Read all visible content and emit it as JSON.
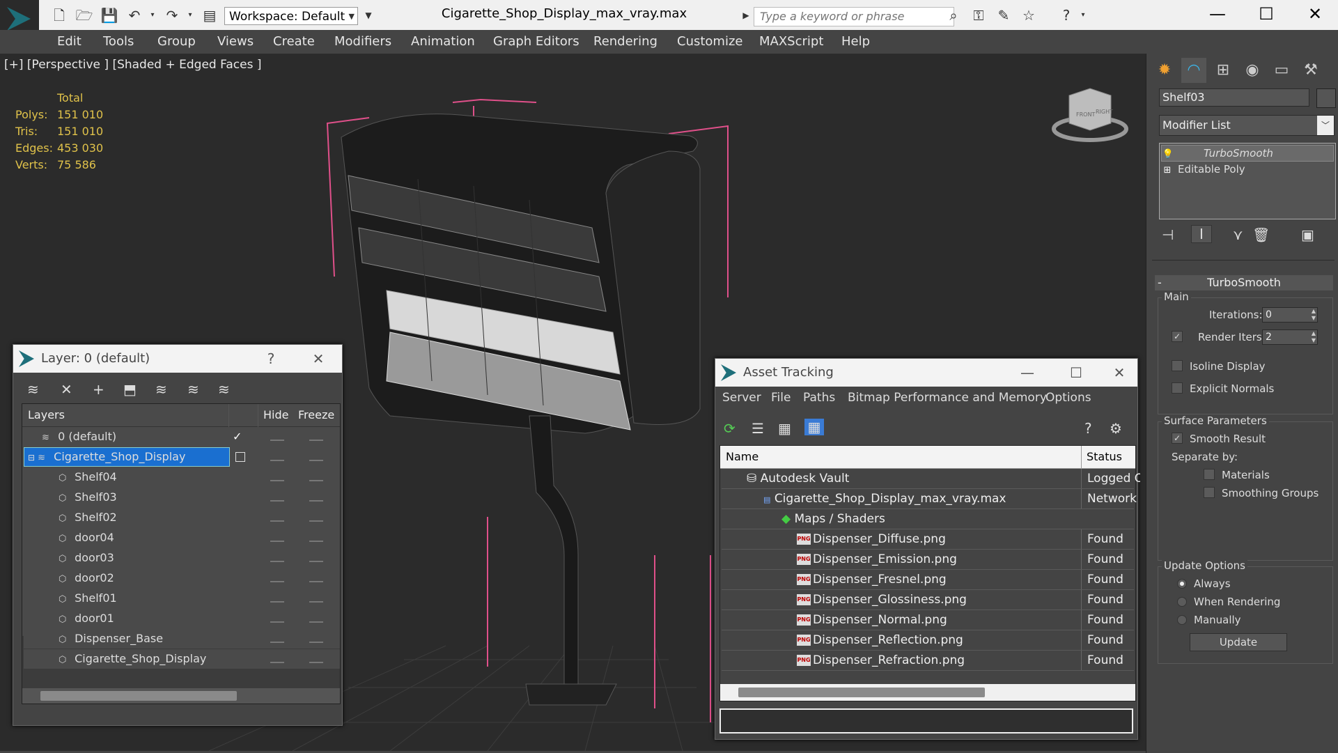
{
  "titlebar": {
    "workspace": "Workspace: Default",
    "window_title": "Cigarette_Shop_Display_max_vray.max",
    "search_placeholder": "Type a keyword or phrase"
  },
  "menu": [
    "Edit",
    "Tools",
    "Group",
    "Views",
    "Create",
    "Modifiers",
    "Animation",
    "Graph Editors",
    "Rendering",
    "Customize",
    "MAXScript",
    "Help"
  ],
  "viewport": {
    "label": "[+] [Perspective ] [Shaded + Edged Faces ]",
    "stats": {
      "header": "Total",
      "rows": [
        {
          "label": "Polys:",
          "value": "151 010"
        },
        {
          "label": "Tris:",
          "value": "151 010"
        },
        {
          "label": "Edges:",
          "value": "453 030"
        },
        {
          "label": "Verts:",
          "value": "75 586"
        }
      ]
    },
    "viewcube_labels": [
      "FRONT",
      "RIGHT"
    ]
  },
  "cmdpanel": {
    "object_name": "Shelf03",
    "modifier_list": "Modifier List",
    "stack": [
      {
        "label": "TurboSmooth",
        "icon": "bulb-icon"
      },
      {
        "label": "Editable Poly",
        "icon": "plus-icon"
      }
    ],
    "rollout_title": "TurboSmooth",
    "main_group": "Main",
    "iterations_label": "Iterations:",
    "iterations_value": "0",
    "render_iters_label": "Render Iters:",
    "render_iters_value": "2",
    "isoline_display": "Isoline Display",
    "explicit_normals": "Explicit Normals",
    "surface_group": "Surface Parameters",
    "smooth_result": "Smooth Result",
    "separate_by": "Separate by:",
    "materials": "Materials",
    "smoothing_groups": "Smoothing Groups",
    "update_group": "Update Options",
    "always": "Always",
    "when_rendering": "When Rendering",
    "manually": "Manually",
    "update_button": "Update"
  },
  "layer_dialog": {
    "title": "Layer: 0 (default)",
    "help": "?",
    "columns": {
      "layers": "Layers",
      "hide": "Hide",
      "freeze": "Freeze"
    },
    "rows": [
      {
        "label": "0 (default)",
        "indent": 1,
        "type": "layer",
        "current": true
      },
      {
        "label": "Cigarette_Shop_Display",
        "indent": 1,
        "type": "layer",
        "selected": true
      },
      {
        "label": "Shelf04",
        "indent": 2,
        "type": "object"
      },
      {
        "label": "Shelf03",
        "indent": 2,
        "type": "object"
      },
      {
        "label": "Shelf02",
        "indent": 2,
        "type": "object"
      },
      {
        "label": "door04",
        "indent": 2,
        "type": "object"
      },
      {
        "label": "door03",
        "indent": 2,
        "type": "object"
      },
      {
        "label": "door02",
        "indent": 2,
        "type": "object"
      },
      {
        "label": "Shelf01",
        "indent": 2,
        "type": "object"
      },
      {
        "label": "door01",
        "indent": 2,
        "type": "object"
      },
      {
        "label": "Dispenser_Base",
        "indent": 2,
        "type": "object"
      },
      {
        "label": "Cigarette_Shop_Display",
        "indent": 2,
        "type": "object"
      }
    ]
  },
  "asset_dialog": {
    "title": "Asset Tracking",
    "menu": [
      "Server",
      "File",
      "Paths",
      "Bitmap Performance and Memory",
      "Options"
    ],
    "columns": {
      "name": "Name",
      "status": "Status"
    },
    "rows": [
      {
        "name": "Autodesk Vault",
        "status": "Logged Out",
        "indent": 1,
        "icon": "vault-icon"
      },
      {
        "name": "Cigarette_Shop_Display_max_vray.max",
        "status": "Network",
        "indent": 2,
        "icon": "max-file-icon"
      },
      {
        "name": "Maps / Shaders",
        "status": "",
        "indent": 3,
        "icon": "maps-icon"
      },
      {
        "name": "Dispenser_Diffuse.png",
        "status": "Found",
        "indent": 4,
        "icon": "png-icon"
      },
      {
        "name": "Dispenser_Emission.png",
        "status": "Found",
        "indent": 4,
        "icon": "png-icon"
      },
      {
        "name": "Dispenser_Fresnel.png",
        "status": "Found",
        "indent": 4,
        "icon": "png-icon"
      },
      {
        "name": "Dispenser_Glossiness.png",
        "status": "Found",
        "indent": 4,
        "icon": "png-icon"
      },
      {
        "name": "Dispenser_Normal.png",
        "status": "Found",
        "indent": 4,
        "icon": "png-icon"
      },
      {
        "name": "Dispenser_Reflection.png",
        "status": "Found",
        "indent": 4,
        "icon": "png-icon"
      },
      {
        "name": "Dispenser_Refraction.png",
        "status": "Found",
        "indent": 4,
        "icon": "png-icon"
      }
    ]
  },
  "colors": {
    "selection": "#1a6fd0",
    "stats_text": "#e0c24a",
    "bbox": "#e0508a"
  }
}
